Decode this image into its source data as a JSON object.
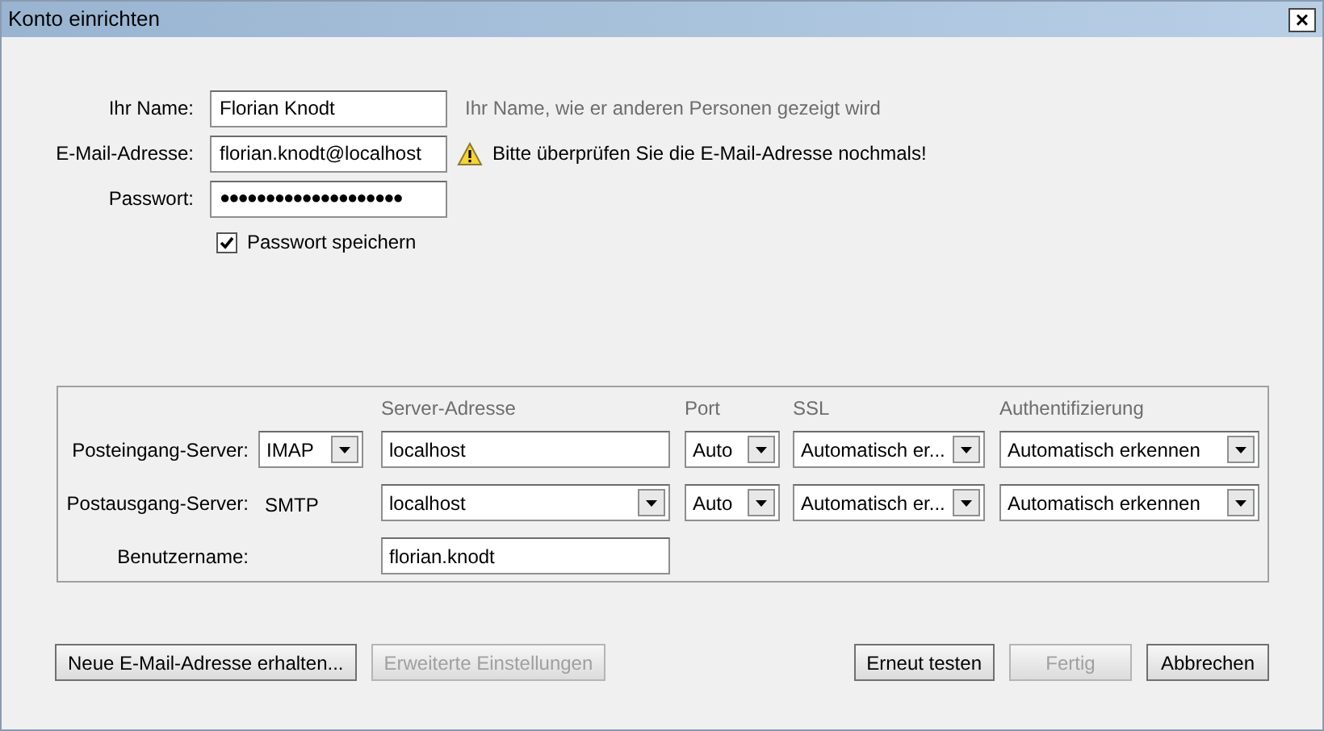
{
  "window": {
    "title": "Konto einrichten",
    "close": "×"
  },
  "identity": [
    {
      "label": "Ihr Name:",
      "value": "Florian Knodt",
      "hint": "Ihr Name, wie er anderen Personen gezeigt wird",
      "warning": false
    },
    {
      "label": "E-Mail-Adresse:",
      "value": "florian.knodt@localhost",
      "hint": "Bitte überprüfen Sie die E-Mail-Adresse nochmals!",
      "warning": true
    },
    {
      "label": "Passwort:",
      "value": "●●●●●●●●●●●●●●●●●●●●",
      "warning": false
    }
  ],
  "remember_password": {
    "label": "Passwort speichern",
    "checked": true
  },
  "server": {
    "columns": [
      "Server-Adresse",
      "Port",
      "SSL",
      "Authentifizierung"
    ],
    "rows": [
      {
        "label": "Posteingang-Server:",
        "protocol": {
          "kind": "select",
          "value": "IMAP"
        },
        "address": {
          "kind": "text",
          "value": "localhost"
        },
        "port": "Auto",
        "ssl": "Automatisch er...",
        "auth": "Automatisch erkennen"
      },
      {
        "label": "Postausgang-Server:",
        "protocol": {
          "kind": "static",
          "value": "SMTP"
        },
        "address": {
          "kind": "select",
          "value": "localhost"
        },
        "port": "Auto",
        "ssl": "Automatisch er...",
        "auth": "Automatisch erkennen"
      },
      {
        "label": "Benutzername:",
        "address": {
          "kind": "text",
          "value": "florian.knodt"
        }
      }
    ]
  },
  "buttons_left": [
    {
      "label": "Neue E-Mail-Adresse erhalten...",
      "disabled": false
    },
    {
      "label": "Erweiterte Einstellungen",
      "disabled": true
    }
  ],
  "buttons_right": [
    {
      "label": "Erneut testen",
      "disabled": false
    },
    {
      "label": "Fertig",
      "disabled": true
    },
    {
      "label": "Abbrechen",
      "disabled": false
    }
  ]
}
